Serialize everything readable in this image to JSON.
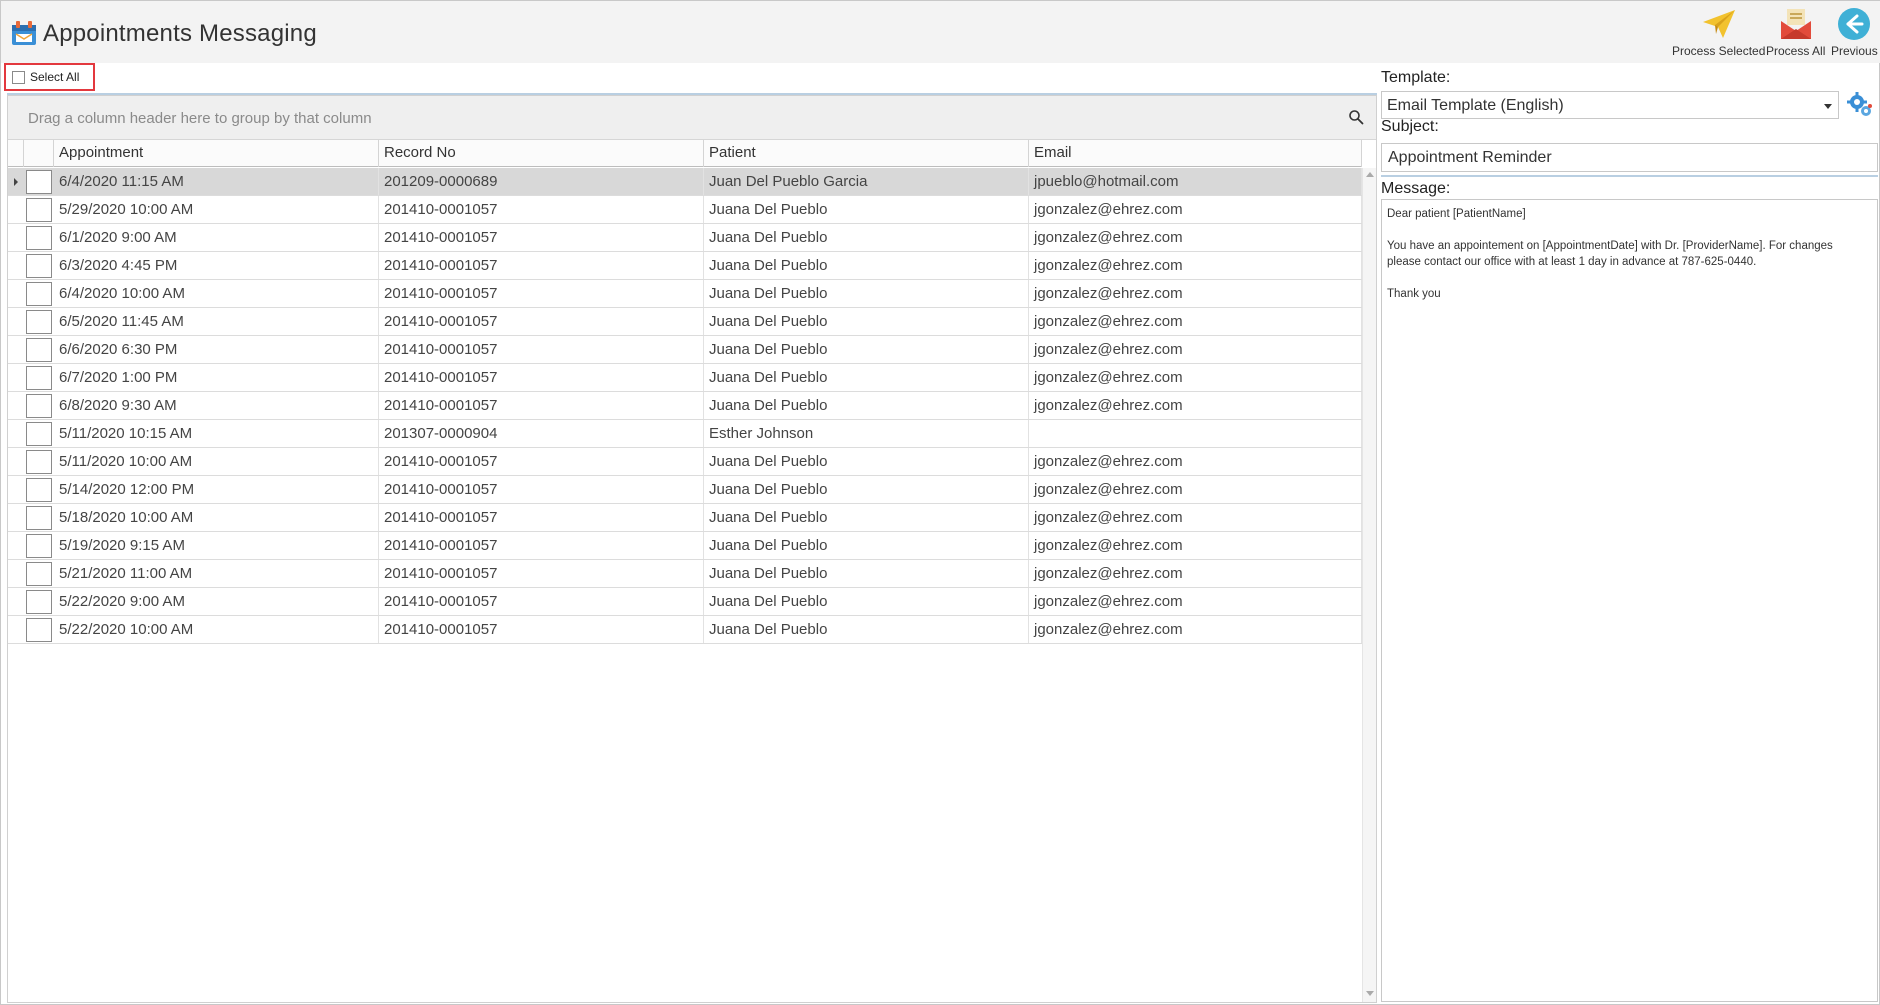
{
  "app": {
    "title": "Appointments Messaging",
    "icon": "calendar-message-icon"
  },
  "toolbar": {
    "process_selected_label": "Process Selected",
    "process_selected_icon": "paper-plane-icon",
    "process_all_label": "Process All",
    "process_all_icon": "open-envelope-icon",
    "previous_label": "Previous",
    "previous_icon": "back-arrow-icon"
  },
  "select_all": {
    "label": "Select All",
    "checked": false
  },
  "grid": {
    "group_panel_text": "Drag a column header here to group by that column",
    "columns": [
      "Appointment",
      "Record No",
      "Patient",
      "Email"
    ],
    "rows": [
      {
        "appointment": "6/4/2020 11:15 AM",
        "record_no": "201209-0000689",
        "patient": "Juan Del Pueblo Garcia",
        "email": "jpueblo@hotmail.com"
      },
      {
        "appointment": "5/29/2020 10:00 AM",
        "record_no": "201410-0001057",
        "patient": "Juana Del Pueblo",
        "email": "jgonzalez@ehrez.com"
      },
      {
        "appointment": "6/1/2020 9:00 AM",
        "record_no": "201410-0001057",
        "patient": "Juana Del Pueblo",
        "email": "jgonzalez@ehrez.com"
      },
      {
        "appointment": "6/3/2020 4:45 PM",
        "record_no": "201410-0001057",
        "patient": "Juana Del Pueblo",
        "email": "jgonzalez@ehrez.com"
      },
      {
        "appointment": "6/4/2020 10:00 AM",
        "record_no": "201410-0001057",
        "patient": "Juana Del Pueblo",
        "email": "jgonzalez@ehrez.com"
      },
      {
        "appointment": "6/5/2020 11:45 AM",
        "record_no": "201410-0001057",
        "patient": "Juana Del Pueblo",
        "email": "jgonzalez@ehrez.com"
      },
      {
        "appointment": "6/6/2020 6:30 PM",
        "record_no": "201410-0001057",
        "patient": "Juana Del Pueblo",
        "email": "jgonzalez@ehrez.com"
      },
      {
        "appointment": "6/7/2020 1:00 PM",
        "record_no": "201410-0001057",
        "patient": "Juana Del Pueblo",
        "email": "jgonzalez@ehrez.com"
      },
      {
        "appointment": "6/8/2020 9:30 AM",
        "record_no": "201410-0001057",
        "patient": "Juana Del Pueblo",
        "email": "jgonzalez@ehrez.com"
      },
      {
        "appointment": "5/11/2020 10:15 AM",
        "record_no": "201307-0000904",
        "patient": "Esther Johnson",
        "email": ""
      },
      {
        "appointment": "5/11/2020 10:00 AM",
        "record_no": "201410-0001057",
        "patient": "Juana Del Pueblo",
        "email": "jgonzalez@ehrez.com"
      },
      {
        "appointment": "5/14/2020 12:00 PM",
        "record_no": "201410-0001057",
        "patient": "Juana Del Pueblo",
        "email": "jgonzalez@ehrez.com"
      },
      {
        "appointment": "5/18/2020 10:00 AM",
        "record_no": "201410-0001057",
        "patient": "Juana Del Pueblo",
        "email": "jgonzalez@ehrez.com"
      },
      {
        "appointment": "5/19/2020 9:15 AM",
        "record_no": "201410-0001057",
        "patient": "Juana Del Pueblo",
        "email": "jgonzalez@ehrez.com"
      },
      {
        "appointment": "5/21/2020 11:00 AM",
        "record_no": "201410-0001057",
        "patient": "Juana Del Pueblo",
        "email": "jgonzalez@ehrez.com"
      },
      {
        "appointment": "5/22/2020 9:00 AM",
        "record_no": "201410-0001057",
        "patient": "Juana Del Pueblo",
        "email": "jgonzalez@ehrez.com"
      },
      {
        "appointment": "5/22/2020 10:00 AM",
        "record_no": "201410-0001057",
        "patient": "Juana Del Pueblo",
        "email": "jgonzalez@ehrez.com"
      }
    ]
  },
  "form": {
    "template_label": "Template:",
    "template_value": "Email Template (English)",
    "subject_label": "Subject:",
    "subject_value": "Appointment Reminder",
    "message_label": "Message:",
    "message_lines": [
      "Dear patient [PatientName]",
      "",
      "You have an appointement on [AppointmentDate] with Dr. [ProviderName]. For changes",
      "please contact our office with at least 1 day in advance at 787-625-0440.",
      "",
      "Thank you"
    ]
  },
  "colors": {
    "accent": "#3a8fd6",
    "highlight_border": "#e3383e",
    "selected_row": "#d8d8d8"
  }
}
